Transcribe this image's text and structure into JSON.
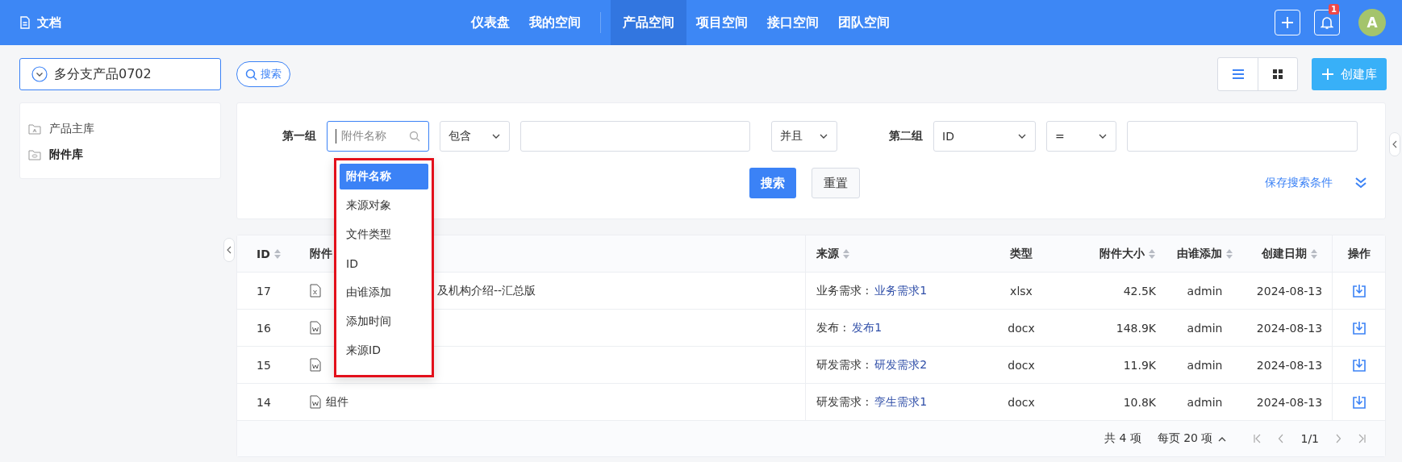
{
  "app": {
    "title": "文档"
  },
  "nav": [
    {
      "label": "仪表盘",
      "selected": false
    },
    {
      "label": "我的空间",
      "selected": false
    },
    {
      "label": "产品空间",
      "selected": true
    },
    {
      "label": "项目空间",
      "selected": false
    },
    {
      "label": "接口空间",
      "selected": false
    },
    {
      "label": "团队空间",
      "selected": false
    }
  ],
  "notifications": {
    "count": "1"
  },
  "avatar": {
    "initial": "A"
  },
  "product_select": {
    "value": "多分支产品0702"
  },
  "search_toggle": {
    "label": "搜索"
  },
  "view_modes": [
    {
      "kind": "list",
      "selected": true
    },
    {
      "kind": "grid",
      "selected": false
    }
  ],
  "create_button": {
    "label": "创建库"
  },
  "libraries": [
    {
      "label": "产品主库",
      "selected": false,
      "kind": "main"
    },
    {
      "label": "附件库",
      "selected": true,
      "kind": "attachment"
    }
  ],
  "filter": {
    "group1": {
      "label": "第一组",
      "field": {
        "placeholder": "附件名称"
      },
      "operator": "包含"
    },
    "join": "并且",
    "group2": {
      "label": "第二组",
      "field": "ID",
      "operator": "="
    },
    "search_button": "搜索",
    "reset_button": "重置",
    "save_link": "保存搜索条件",
    "field_menu": [
      {
        "label": "附件名称",
        "selected": true
      },
      {
        "label": "来源对象",
        "selected": false
      },
      {
        "label": "文件类型",
        "selected": false
      },
      {
        "label": "ID",
        "selected": false
      },
      {
        "label": "由谁添加",
        "selected": false
      },
      {
        "label": "添加时间",
        "selected": false
      },
      {
        "label": "来源ID",
        "selected": false
      }
    ]
  },
  "table": {
    "columns": [
      {
        "label": "ID",
        "sortable": true
      },
      {
        "label": "附件",
        "sortable": false
      },
      {
        "label": "来源",
        "sortable": true
      },
      {
        "label": "类型",
        "sortable": false
      },
      {
        "label": "附件大小",
        "sortable": true
      },
      {
        "label": "由谁添加",
        "sortable": true
      },
      {
        "label": "创建日期",
        "sortable": true
      },
      {
        "label": "操作",
        "sortable": false
      }
    ],
    "rows": [
      {
        "id": "17",
        "kind": "excel",
        "name": "及机构介绍--汇总版",
        "name_under_menu": true,
        "source_type": "业务需求 :",
        "source_link": "业务需求1",
        "type": "xlsx",
        "size": "42.5K",
        "added_by": "admin",
        "date": "2024-08-13"
      },
      {
        "id": "16",
        "kind": "word",
        "source_type": "发布 :",
        "source_link": "发布1",
        "type": "docx",
        "size": "148.9K",
        "added_by": "admin",
        "date": "2024-08-13"
      },
      {
        "id": "15",
        "kind": "word",
        "source_type": "研发需求 :",
        "source_link": "研发需求2",
        "type": "docx",
        "size": "11.9K",
        "added_by": "admin",
        "date": "2024-08-13"
      },
      {
        "id": "14",
        "kind": "word",
        "name": "组件",
        "source_type": "研发需求 :",
        "source_link": "孪生需求1",
        "type": "docx",
        "size": "10.8K",
        "added_by": "admin",
        "date": "2024-08-13"
      }
    ]
  },
  "pagination": {
    "total": "共 4 项",
    "page_size": "每页 20 项",
    "page": "1/1"
  }
}
